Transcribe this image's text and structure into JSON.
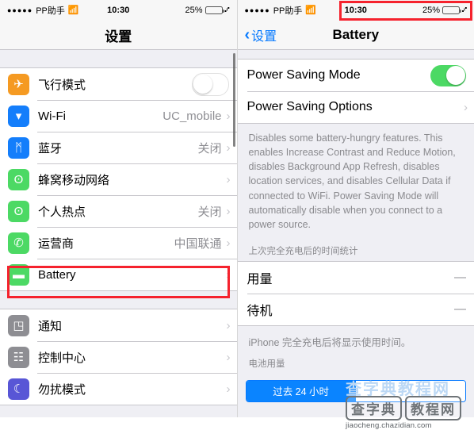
{
  "left": {
    "status_bar": {
      "signal_dots": "●●●●●",
      "carrier": "PP助手",
      "wifi_icon": "wifi-icon",
      "time": "10:30",
      "battery_percent": "25%",
      "battery_fill_color": "#3ad23a",
      "battery_level": 25,
      "charging_bolt": "⑇"
    },
    "nav": {
      "title": "设置"
    },
    "groups": [
      {
        "rows": [
          {
            "label": "飞行模式",
            "icon": "airplane-icon",
            "glyph": "✈",
            "icon_color": "#f59a22",
            "control": "toggle",
            "toggle_on": false
          },
          {
            "label": "Wi-Fi",
            "icon": "wifi-icon",
            "glyph": "▾",
            "icon_color": "#147efb",
            "value": "UC_mobile",
            "control": "chevron"
          },
          {
            "label": "蓝牙",
            "icon": "bluetooth-icon",
            "glyph": "ᛗ",
            "icon_color": "#147efb",
            "value": "关闭",
            "control": "chevron"
          },
          {
            "label": "蜂窝移动网络",
            "icon": "cellular-icon",
            "glyph": "ʘ",
            "icon_color": "#4cd964",
            "value": "",
            "control": "chevron"
          },
          {
            "label": "个人热点",
            "icon": "hotspot-icon",
            "glyph": "ʘ",
            "icon_color": "#4cd964",
            "value": "关闭",
            "control": "chevron"
          },
          {
            "label": "运营商",
            "icon": "phone-icon",
            "glyph": "✆",
            "icon_color": "#4cd964",
            "value": "中国联通",
            "control": "chevron"
          },
          {
            "label": "Battery",
            "icon": "battery-icon",
            "glyph": "▬",
            "icon_color": "#4cd964",
            "value": "",
            "control": "chevron",
            "highlighted": true
          }
        ]
      },
      {
        "rows": [
          {
            "label": "通知",
            "icon": "notifications-icon",
            "glyph": "◳",
            "icon_color": "#8e8e93",
            "value": "",
            "control": "chevron"
          },
          {
            "label": "控制中心",
            "icon": "control-center-icon",
            "glyph": "☷",
            "icon_color": "#8e8e93",
            "value": "",
            "control": "chevron"
          },
          {
            "label": "勿扰模式",
            "icon": "moon-icon",
            "glyph": "☾",
            "icon_color": "#5856d6",
            "value": "",
            "control": "chevron"
          }
        ]
      }
    ]
  },
  "right": {
    "status_bar": {
      "signal_dots": "●●●●●",
      "carrier": "PP助手",
      "wifi_icon": "wifi-icon",
      "time": "10:30",
      "battery_percent": "25%",
      "battery_fill_color": "#ffb200",
      "battery_level": 25,
      "charging_bolt": "⑇"
    },
    "nav": {
      "back_label": "设置",
      "back_icon": "chevron-left-icon",
      "title": "Battery"
    },
    "power_rows": [
      {
        "label": "Power Saving Mode",
        "control": "toggle",
        "toggle_on": true
      },
      {
        "label": "Power Saving Options",
        "control": "chevron"
      }
    ],
    "description": "Disables some battery-hungry features. This enables Increase Contrast and Reduce Motion, disables Background App Refresh, disables location services, and disables Cellular Data if connected to WiFi. Power Saving Mode will automatically disable when you connect to a power source.",
    "stats_header": "上次完全充电后的时间统计",
    "stats_rows": [
      {
        "label": "用量",
        "value": "—"
      },
      {
        "label": "待机",
        "value": "—"
      }
    ],
    "footer_note": "iPhone 完全充电后将显示使用时间。",
    "usage_header": "电池用量",
    "segments": [
      {
        "label": "过去 24 小时",
        "active": true
      },
      {
        "label": "",
        "active": false
      }
    ]
  },
  "watermark": {
    "top_text": "查字典教程网",
    "badge_left": "查字典",
    "badge_right": "教程网",
    "url": "jiaocheng.chazidian.com"
  },
  "accent": {
    "ios_blue": "#0579ff",
    "green": "#4cd964",
    "highlight_red": "#f5222d"
  }
}
